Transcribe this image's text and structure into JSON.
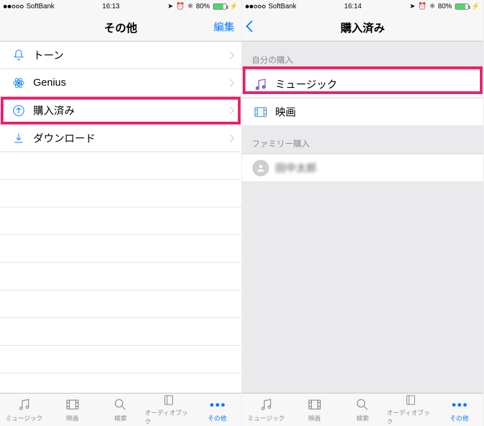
{
  "left": {
    "status": {
      "carrier": "SoftBank",
      "time": "16:13",
      "battery": "80%",
      "signal": 2
    },
    "nav": {
      "title": "その他",
      "edit": "編集"
    },
    "rows": [
      {
        "icon": "bell",
        "label": "トーン"
      },
      {
        "icon": "atom",
        "label": "Genius"
      },
      {
        "icon": "disc",
        "label": "購入済み"
      },
      {
        "icon": "dl",
        "label": "ダウンロード"
      }
    ],
    "highlight_index": 2
  },
  "right": {
    "status": {
      "carrier": "SoftBank",
      "time": "16:14",
      "battery": "80%",
      "signal": 2
    },
    "nav": {
      "title": "購入済み"
    },
    "section1_hdr": "自分の購入",
    "section1": [
      {
        "icon": "music",
        "label": "ミュージック"
      },
      {
        "icon": "film",
        "label": "映画"
      }
    ],
    "section2_hdr": "ファミリー購入",
    "section2": [
      {
        "icon": "avatar",
        "label": "田中太郎"
      }
    ],
    "highlight_index": 0
  },
  "tabs": [
    {
      "id": "music",
      "label": "ミュージック"
    },
    {
      "id": "film",
      "label": "映画"
    },
    {
      "id": "search",
      "label": "検索"
    },
    {
      "id": "audio",
      "label": "オーディオブック"
    },
    {
      "id": "more",
      "label": "その他",
      "active": true
    }
  ]
}
